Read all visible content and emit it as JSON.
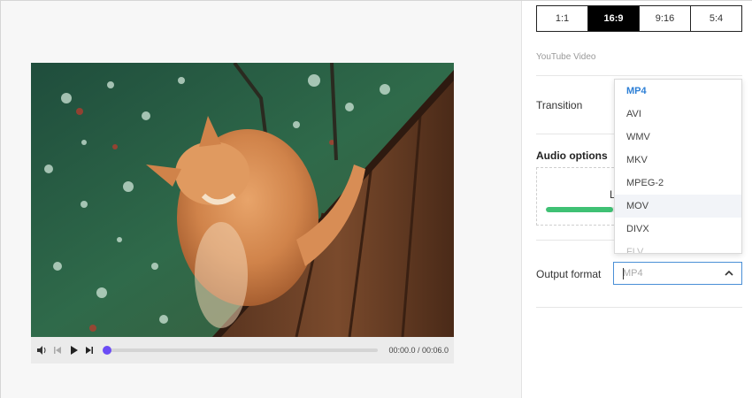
{
  "player": {
    "time_current": "00:00.0",
    "time_total": "00:06.0",
    "time_separator": " / ",
    "progress_fraction": 0.01,
    "accent_color": "#6b4cf5"
  },
  "aspect_ratios": {
    "options": [
      "1:1",
      "16:9",
      "9:16",
      "5:4"
    ],
    "selected": "16:9",
    "caption": "YouTube Video"
  },
  "transition": {
    "label": "Transition"
  },
  "audio_options": {
    "title": "Audio options",
    "box_text": "L",
    "level_fraction": 0.36,
    "level_color": "#3fc174"
  },
  "output_format": {
    "label": "Output format",
    "value": "MP4",
    "options": [
      "MP4",
      "AVI",
      "WMV",
      "MKV",
      "MPEG-2",
      "MOV",
      "DIVX",
      "FLV"
    ],
    "selected_option": "MP4",
    "hovered_option": "MOV",
    "selected_color": "#2d7fd6"
  }
}
